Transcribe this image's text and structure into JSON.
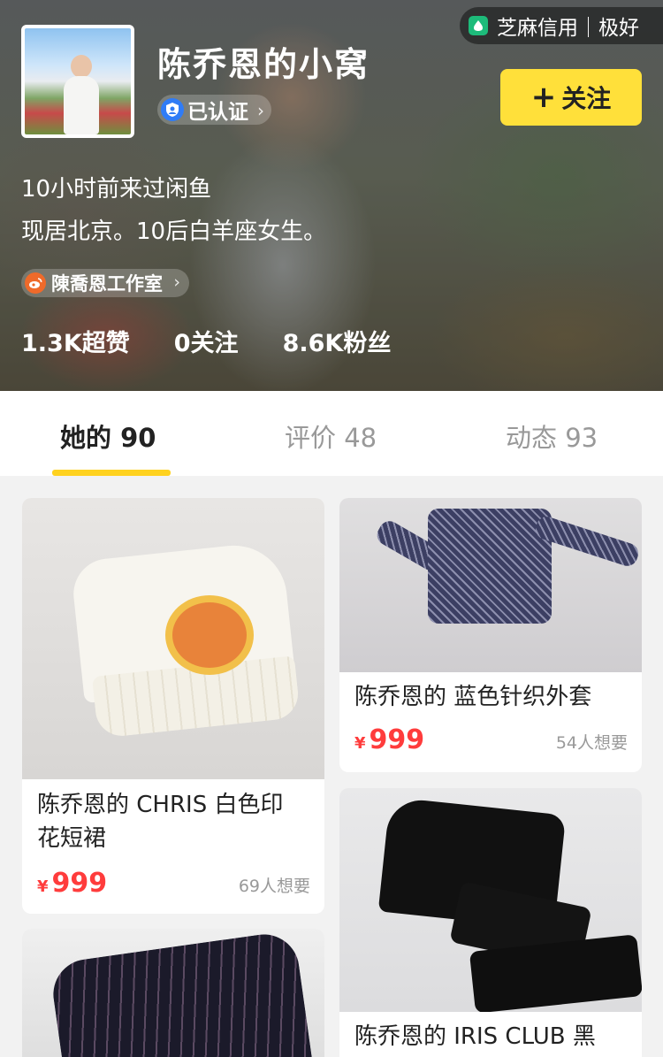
{
  "profile": {
    "shop_name": "陈乔恩的小窝",
    "verified_label": "已认证",
    "sesame_label": "芝麻信用｜极好",
    "follow_label": "关注",
    "last_seen": "10小时前来过闲鱼",
    "bio": "现居北京。10后白羊座女生。",
    "weibo_label": "陳喬恩工作室",
    "stats": {
      "super_likes": "1.3K超赞",
      "following": "0关注",
      "fans": "8.6K粉丝"
    }
  },
  "tabs": [
    {
      "label": "她的 90",
      "active": true
    },
    {
      "label": "评价 48",
      "active": false
    },
    {
      "label": "动态 93",
      "active": false
    }
  ],
  "products": [
    {
      "title_line1": "陈乔恩的 CHRIS 白色印",
      "title_line2": "花短裙",
      "currency": "¥",
      "price": "999",
      "wants": "69人想要"
    },
    {
      "title_line1": "陈乔恩的 蓝色针织外套",
      "currency": "¥",
      "price": "999",
      "wants": "54人想要"
    },
    {
      "title_line1": "陈乔恩的 IRIS CLUB 黑"
    },
    {}
  ]
}
